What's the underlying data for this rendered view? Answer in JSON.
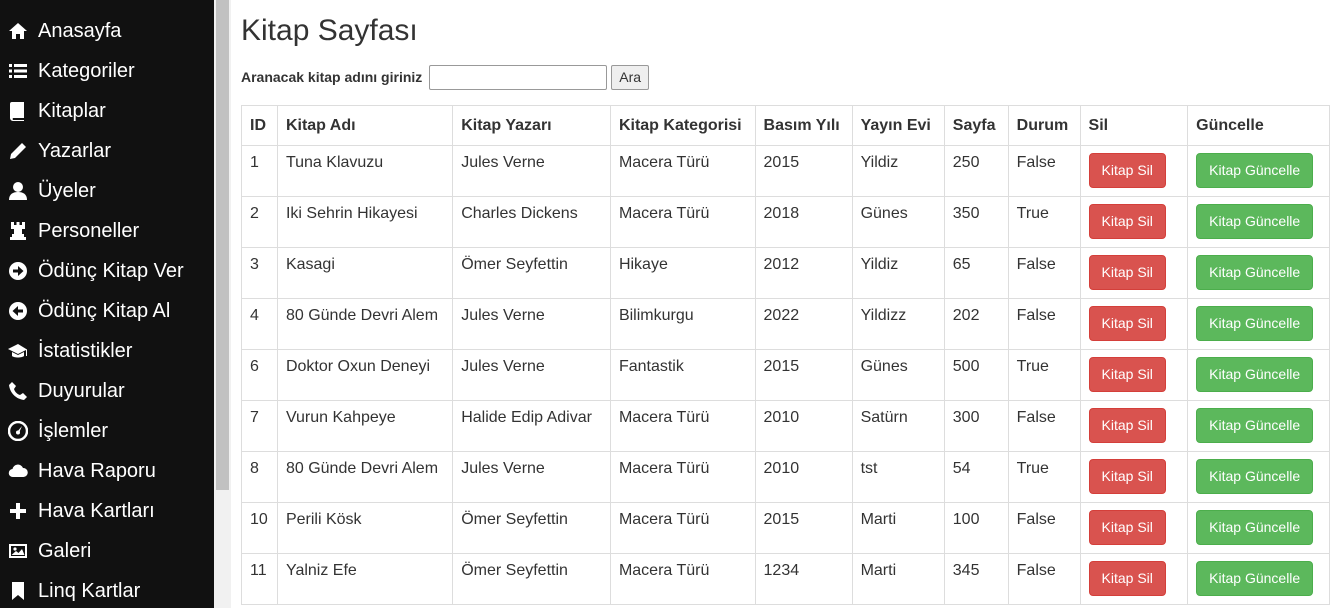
{
  "sidebar": {
    "items": [
      {
        "label": "Anasayfa",
        "icon": "home-icon"
      },
      {
        "label": "Kategoriler",
        "icon": "list-icon"
      },
      {
        "label": "Kitaplar",
        "icon": "book-icon"
      },
      {
        "label": "Yazarlar",
        "icon": "pencil-icon"
      },
      {
        "label": "Üyeler",
        "icon": "user-icon"
      },
      {
        "label": "Personeller",
        "icon": "tower-icon"
      },
      {
        "label": "Ödünç Kitap Ver",
        "icon": "circle-arrow-right-icon"
      },
      {
        "label": "Ödünç Kitap Al",
        "icon": "circle-arrow-left-icon"
      },
      {
        "label": "İstatistikler",
        "icon": "education-icon"
      },
      {
        "label": "Duyurular",
        "icon": "phone-icon"
      },
      {
        "label": "İşlemler",
        "icon": "dashboard-icon"
      },
      {
        "label": "Hava Raporu",
        "icon": "cloud-icon"
      },
      {
        "label": "Hava Kartları",
        "icon": "plus-icon"
      },
      {
        "label": "Galeri",
        "icon": "picture-icon"
      },
      {
        "label": "Linq Kartlar",
        "icon": "bookmark-icon"
      }
    ]
  },
  "main": {
    "title": "Kitap Sayfası",
    "search": {
      "label": "Aranacak kitap adını giriniz",
      "value": "",
      "placeholder": "",
      "button_label": "Ara"
    },
    "table": {
      "headers": [
        "ID",
        "Kitap Adı",
        "Kitap Yazarı",
        "Kitap Kategorisi",
        "Basım Yılı",
        "Yayın Evi",
        "Sayfa",
        "Durum",
        "Sil",
        "Güncelle"
      ],
      "delete_label": "Kitap Sil",
      "update_label": "Kitap Güncelle",
      "rows": [
        [
          "1",
          "Tuna Klavuzu",
          "Jules  Verne",
          "Macera Türü",
          "2015",
          "Yildiz",
          "250",
          "False"
        ],
        [
          "2",
          "Iki Sehrin Hikayesi",
          "Charles  Dickens",
          "Macera Türü",
          "2018",
          "Günes",
          "350",
          "True"
        ],
        [
          "3",
          "Kasagi",
          "Ömer  Seyfettin",
          "Hikaye",
          "2012",
          "Yildiz",
          "65",
          "False"
        ],
        [
          "4",
          "80 Günde Devri Alem",
          "Jules  Verne",
          "Bilimkurgu",
          "2022",
          "Yildizz",
          "202",
          "False"
        ],
        [
          "6",
          "Doktor Oxun Deneyi",
          "Jules  Verne",
          "Fantastik",
          "2015",
          "Günes",
          "500",
          "True"
        ],
        [
          "7",
          "Vurun Kahpeye",
          "Halide Edip  Adivar",
          "Macera Türü",
          "2010",
          "Satürn",
          "300",
          "False"
        ],
        [
          "8",
          "80 Günde Devri Alem",
          "Jules  Verne",
          "Macera Türü",
          "2010",
          "tst",
          "54",
          "True"
        ],
        [
          "10",
          "Perili Kösk",
          "Ömer  Seyfettin",
          "Macera Türü",
          "2015",
          "Marti",
          "100",
          "False"
        ],
        [
          "11",
          "Yalniz Efe",
          "Ömer  Seyfettin",
          "Macera Türü",
          "1234",
          "Marti",
          "345",
          "False"
        ]
      ]
    }
  },
  "colors": {
    "sidebar_bg": "#111111",
    "danger": "#d9534f",
    "success": "#5cb85c"
  }
}
